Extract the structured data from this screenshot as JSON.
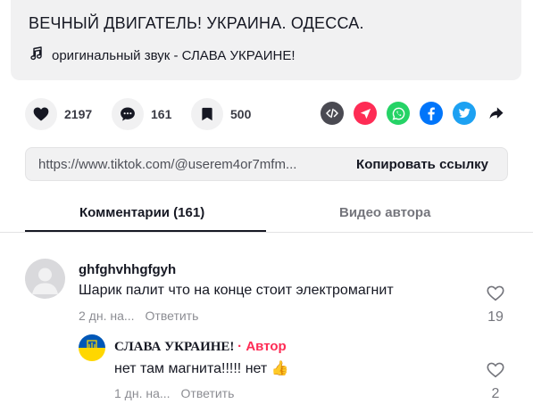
{
  "video": {
    "title": "ВЕЧНЫЙ ДВИГАТЕЛЬ! УКРАИНА. ОДЕССА.",
    "sound": "оригинальный звук - СЛАВА УКРАИНЕ!"
  },
  "actions": {
    "likes": "2197",
    "comments": "161",
    "saves": "500"
  },
  "share_icons": [
    "embed-icon",
    "send-icon",
    "whatsapp-icon",
    "facebook-icon",
    "twitter-icon",
    "share-arrow-icon"
  ],
  "colors": {
    "embed": "#4a4a52",
    "send": "#fe2c55",
    "whatsapp": "#25d366",
    "facebook": "#0075fa",
    "twitter": "#1da1f2",
    "author": "#fe2c55"
  },
  "link": {
    "url": "https://www.tiktok.com/@userem4or7mfm...",
    "copy_label": "Копировать ссылку"
  },
  "tabs": {
    "comments": "Комментарии (161)",
    "author_videos": "Видео автора"
  },
  "comments": [
    {
      "user": "ghfghvhhgfgyh",
      "text": "Шарик палит что на конце стоит электромагнит",
      "time": "2 дн. на...",
      "reply": "Ответить",
      "likes": "19",
      "replies": [
        {
          "user": "СЛАВА УКРАИНЕ!",
          "badge": "· Автор",
          "text": "нет там магнита!!!!! нет 👍",
          "time": "1 дн. на...",
          "reply": "Ответить",
          "likes": "2"
        }
      ]
    }
  ]
}
